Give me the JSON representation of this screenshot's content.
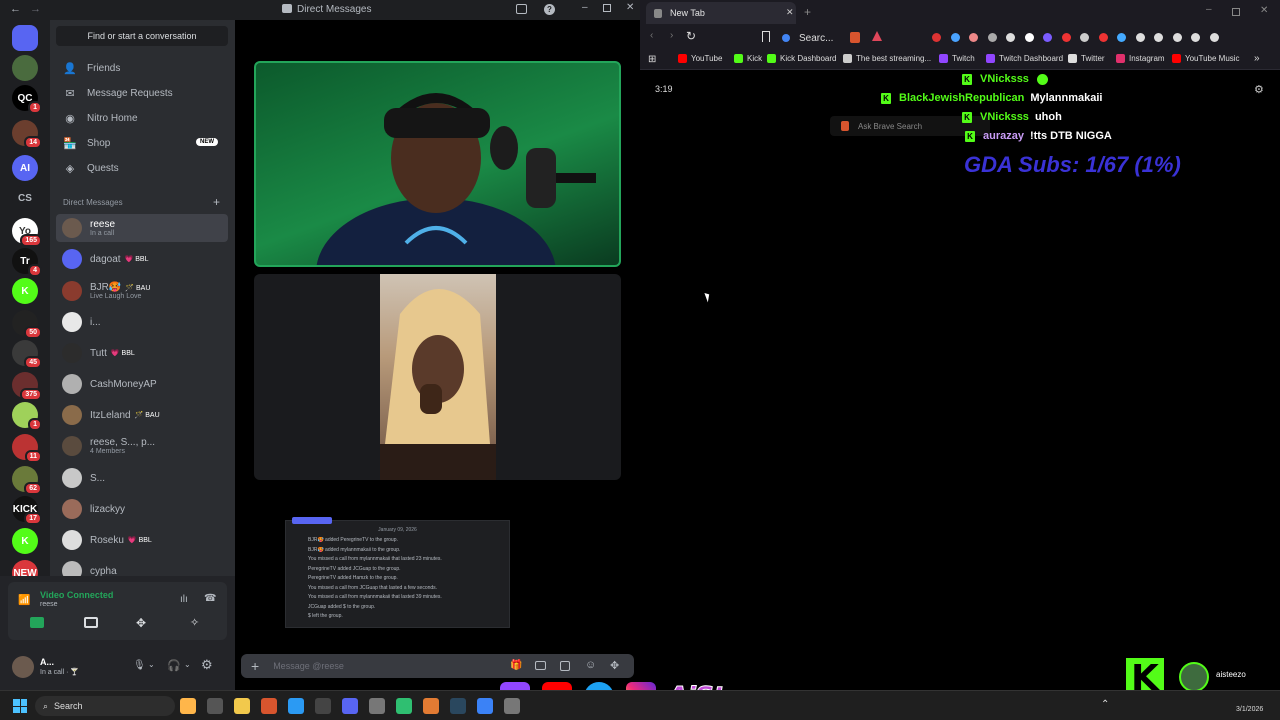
{
  "discord": {
    "window_title": "Direct Messages",
    "find_placeholder": "Find or start a conversation",
    "nav": [
      {
        "label": "Friends",
        "icon": "friends-icon"
      },
      {
        "label": "Message Requests",
        "icon": "envelope-icon"
      },
      {
        "label": "Nitro Home",
        "icon": "nitro-icon"
      },
      {
        "label": "Shop",
        "icon": "shop-icon",
        "badge": "NEW"
      },
      {
        "label": "Quests",
        "icon": "quests-icon"
      }
    ],
    "dm_header": "Direct Messages",
    "dms": [
      {
        "name": "reese",
        "sub": "In a call",
        "active": true,
        "color": "#6b5a4e"
      },
      {
        "name": "dagoat",
        "tag": "💗 BBL",
        "color": "#5865f2"
      },
      {
        "name": "BJR🥵",
        "tag": "🪄 BAU",
        "sub": "Live Laugh Love",
        "color": "#8a3b2e"
      },
      {
        "name": "i...",
        "color": "#e8e8e8"
      },
      {
        "name": "Tutt",
        "tag": "💗 BBL",
        "color": "#2c2c2c"
      },
      {
        "name": "CashMoneyAP",
        "color": "#b0b0b0"
      },
      {
        "name": "ItzLeland",
        "tag": "🪄 BAU",
        "color": "#8a6b4a"
      },
      {
        "name": "reese, S..., p...",
        "sub": "4 Members",
        "color": "#5a4b3e"
      },
      {
        "name": "S...",
        "color": "#c8c8c8"
      },
      {
        "name": "lizackyy",
        "color": "#9a6b5a"
      },
      {
        "name": "Roseku",
        "tag": "💗 BBL",
        "color": "#ddd"
      },
      {
        "name": "cypha",
        "color": "#bbb"
      }
    ],
    "servers": [
      {
        "label": "",
        "badge": "",
        "color": "#5865f2"
      },
      {
        "label": "",
        "badge": "",
        "color": "#4a6b3e"
      },
      {
        "label": "QC",
        "badge": "1",
        "color": "#000"
      },
      {
        "label": "",
        "badge": "14",
        "color": "#6b3e2e"
      },
      {
        "label": "AI",
        "badge": "",
        "color": "#5865f2"
      },
      {
        "label": "CS",
        "badge": "",
        "color": "#1e1f22"
      },
      {
        "label": "Yo",
        "badge": "165",
        "color": "#fff"
      },
      {
        "label": "Tr",
        "badge": "4",
        "color": "#111"
      },
      {
        "label": "K",
        "badge": "",
        "color": "#53fc18"
      },
      {
        "label": "",
        "badge": "50",
        "color": "#222"
      },
      {
        "label": "",
        "badge": "45",
        "color": "#3a3a3a"
      },
      {
        "label": "",
        "badge": "375",
        "color": "#6b2e2e"
      },
      {
        "label": "",
        "badge": "1",
        "color": "#9fd15a"
      },
      {
        "label": "",
        "badge": "11",
        "color": "#b33"
      },
      {
        "label": "",
        "badge": "62",
        "color": "#6a7a3a"
      },
      {
        "label": "KICK",
        "badge": "17",
        "color": "#111"
      },
      {
        "label": "K",
        "badge": "",
        "color": "#53fc18"
      },
      {
        "label": "NEW",
        "badge": "129",
        "color": "#da373c"
      }
    ],
    "voice": {
      "status": "Video Connected",
      "channel": "reese"
    },
    "user": {
      "name": "A...",
      "status": "In a call · 🍸"
    },
    "message_placeholder": "Message @reese",
    "chatlog": {
      "date": "January 09, 2026",
      "lines": [
        "BJR🥵 added PeregrineTV to the group.",
        "BJR🥵 added mylannmakaii to the group.",
        "You missed a call from mylannmakaii that lasted 23 minutes.",
        "PeregrineTV added JCGuap to the group.",
        "PeregrineTV added Hamzk to the group.",
        "You missed a call from JCGuap that lasted a few seconds.",
        "You missed a call from mylannmakaii that lasted 39 minutes.",
        "JCGuap added $ to the group.",
        "$ left the group."
      ]
    }
  },
  "browser": {
    "tab_title": "New Tab",
    "search_label": "Searc...",
    "bookmarks": [
      {
        "label": "YouTube",
        "color": "#ff0000"
      },
      {
        "label": "Kick",
        "color": "#53fc18"
      },
      {
        "label": "Kick Dashboard",
        "color": "#53fc18"
      },
      {
        "label": "The best streaming...",
        "color": "#ccc"
      },
      {
        "label": "Twitch",
        "color": "#9146ff"
      },
      {
        "label": "Twitch Dashboard",
        "color": "#9146ff"
      },
      {
        "label": "Twitter",
        "color": "#ddd"
      },
      {
        "label": "Instagram",
        "color": "#e1306c"
      },
      {
        "label": "YouTube Music",
        "color": "#ff0000"
      }
    ],
    "clock": "3:19",
    "brave_search_placeholder": "Ask Brave Search",
    "chat": [
      {
        "user": "VNicksss",
        "msg": "",
        "user_color": "#53fc18"
      },
      {
        "user": "BlackJewishRepublican",
        "msg": "Mylannmakaii",
        "user_color": "#53fc18"
      },
      {
        "user": "VNicksss",
        "msg": "uhoh",
        "user_color": "#53fc18"
      },
      {
        "user": "aurazay",
        "msg": "!tts DTB NIGGA",
        "user_color": "#c99cf6"
      }
    ],
    "gda_text": "GDA Subs: 1/67 (1%)"
  },
  "overlay": {
    "handle": "AiSteezo",
    "kick_name": "aisteezo"
  },
  "taskbar": {
    "search_label": "Search",
    "date": "3/1/2026"
  }
}
